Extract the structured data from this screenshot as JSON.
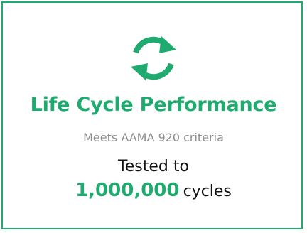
{
  "colors": {
    "accent": "#1faa6f",
    "border": "#1faa6f",
    "subtitle": "#8c8c8c",
    "text": "#111111"
  },
  "icon": "refresh-cycle-icon",
  "title": "Life Cycle Performance",
  "subtitle": "Meets AAMA 920 criteria",
  "tested_prefix": "Tested to",
  "cycle_count": "1,000,000",
  "cycle_unit": "cycles"
}
